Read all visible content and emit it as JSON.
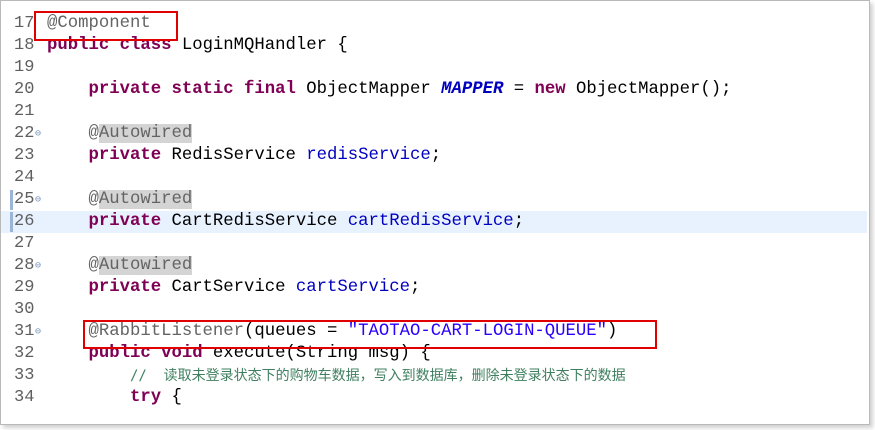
{
  "editor": {
    "lines": [
      {
        "num": "17",
        "tokens": [
          {
            "t": "@Component",
            "c": "ann"
          }
        ]
      },
      {
        "num": "18",
        "tokens": [
          {
            "t": "public class",
            "c": "kw"
          },
          {
            "t": " LoginMQHandler {",
            "c": ""
          }
        ]
      },
      {
        "num": "19",
        "tokens": []
      },
      {
        "num": "20",
        "tokens": [
          {
            "t": "    ",
            "c": ""
          },
          {
            "t": "private static final",
            "c": "kw"
          },
          {
            "t": " ObjectMapper ",
            "c": ""
          },
          {
            "t": "MAPPER",
            "c": "static-field"
          },
          {
            "t": " = ",
            "c": ""
          },
          {
            "t": "new",
            "c": "kw"
          },
          {
            "t": " ObjectMapper();",
            "c": ""
          }
        ]
      },
      {
        "num": "21",
        "tokens": []
      },
      {
        "num": "22",
        "fold": true,
        "tokens": [
          {
            "t": "    ",
            "c": ""
          },
          {
            "t": "@",
            "c": "ann"
          },
          {
            "t": "Autowired",
            "c": "ann-hl"
          }
        ]
      },
      {
        "num": "23",
        "tokens": [
          {
            "t": "    ",
            "c": ""
          },
          {
            "t": "private",
            "c": "kw"
          },
          {
            "t": " RedisService ",
            "c": ""
          },
          {
            "t": "redisService",
            "c": "field"
          },
          {
            "t": ";",
            "c": ""
          }
        ]
      },
      {
        "num": "24",
        "tokens": []
      },
      {
        "num": "25",
        "fold": true,
        "mark": true,
        "tokens": [
          {
            "t": "    ",
            "c": ""
          },
          {
            "t": "@",
            "c": "ann"
          },
          {
            "t": "Autowired",
            "c": "ann-hl"
          }
        ]
      },
      {
        "num": "26",
        "current": true,
        "mark": true,
        "tokens": [
          {
            "t": "    ",
            "c": ""
          },
          {
            "t": "private",
            "c": "kw"
          },
          {
            "t": " CartRedisService ",
            "c": ""
          },
          {
            "t": "cartRedisService",
            "c": "field"
          },
          {
            "t": ";",
            "c": ""
          }
        ]
      },
      {
        "num": "27",
        "tokens": []
      },
      {
        "num": "28",
        "fold": true,
        "tokens": [
          {
            "t": "    ",
            "c": ""
          },
          {
            "t": "@",
            "c": "ann"
          },
          {
            "t": "Autowired",
            "c": "ann-hl"
          }
        ]
      },
      {
        "num": "29",
        "tokens": [
          {
            "t": "    ",
            "c": ""
          },
          {
            "t": "private",
            "c": "kw"
          },
          {
            "t": " CartService ",
            "c": ""
          },
          {
            "t": "cartService",
            "c": "field"
          },
          {
            "t": ";",
            "c": ""
          }
        ]
      },
      {
        "num": "30",
        "tokens": []
      },
      {
        "num": "31",
        "fold": true,
        "tokens": [
          {
            "t": "    ",
            "c": ""
          },
          {
            "t": "@RabbitListener",
            "c": "ann"
          },
          {
            "t": "(queues = ",
            "c": ""
          },
          {
            "t": "\"TAOTAO-CART-LOGIN-QUEUE\"",
            "c": "str"
          },
          {
            "t": ")",
            "c": ""
          }
        ]
      },
      {
        "num": "32",
        "tokens": [
          {
            "t": "    ",
            "c": ""
          },
          {
            "t": "public void",
            "c": "kw"
          },
          {
            "t": " execute(String msg) {",
            "c": ""
          }
        ]
      },
      {
        "num": "33",
        "tokens": [
          {
            "t": "        ",
            "c": ""
          },
          {
            "t": "//  读取未登录状态下的购物车数据，写入到数据库，删除未登录状态下的数据",
            "c": "cmt"
          }
        ]
      },
      {
        "num": "34",
        "tokens": [
          {
            "t": "        ",
            "c": ""
          },
          {
            "t": "try",
            "c": "kw"
          },
          {
            "t": " {",
            "c": ""
          }
        ]
      }
    ]
  },
  "colors": {
    "keyword": "#7f0055",
    "annotation": "#646464",
    "field": "#0000c0",
    "string": "#2a00ff",
    "comment": "#3f7f5f",
    "current_line": "#e8f2fe",
    "highlight_box": "#e00000"
  },
  "icons": {
    "fold": "fold-collapse-icon"
  }
}
